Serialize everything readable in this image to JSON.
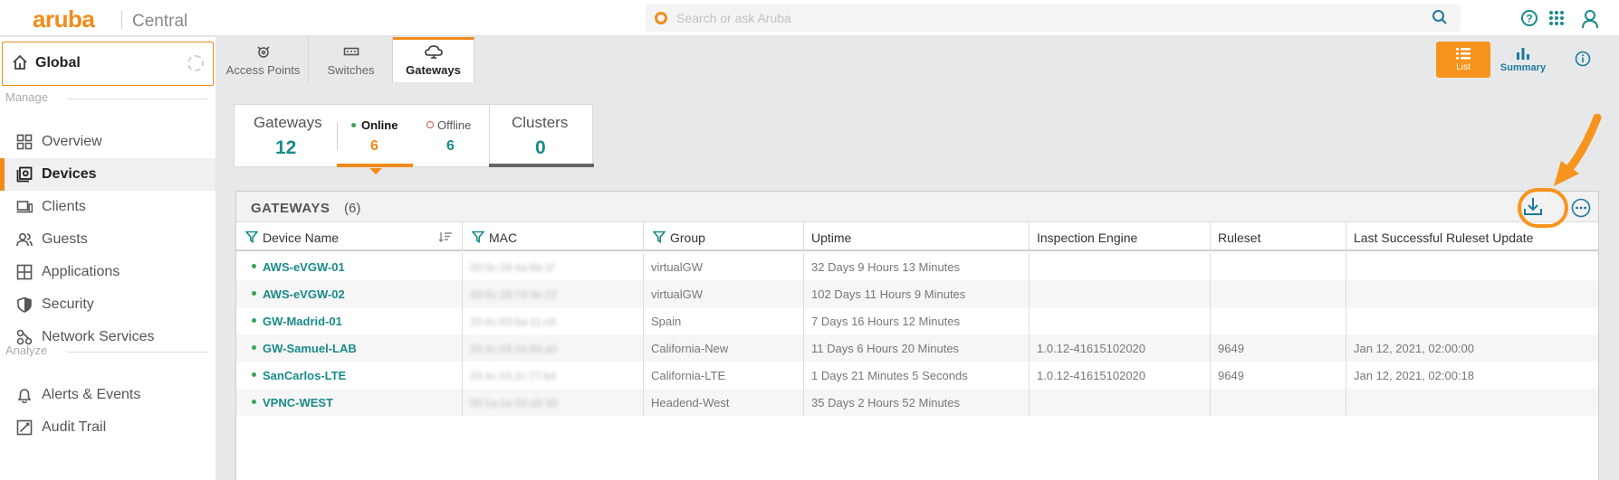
{
  "app": {
    "brand": "aruba",
    "product": "Central",
    "search_placeholder": "Search or ask Aruba"
  },
  "colors": {
    "accent": "#f28b1a",
    "teal": "#1a8a8a",
    "online": "#3aa35b",
    "offline": "#d9534f"
  },
  "sidebar": {
    "scope_label": "Global",
    "sections": [
      {
        "title": "Manage"
      },
      {
        "title": "Analyze"
      }
    ],
    "items": [
      {
        "label": "Overview",
        "icon": "grid-icon"
      },
      {
        "label": "Devices",
        "icon": "devices-icon",
        "active": true
      },
      {
        "label": "Clients",
        "icon": "clients-icon"
      },
      {
        "label": "Guests",
        "icon": "guests-icon"
      },
      {
        "label": "Applications",
        "icon": "apps-icon"
      },
      {
        "label": "Security",
        "icon": "shield-icon"
      },
      {
        "label": "Network Services",
        "icon": "network-services-icon"
      },
      {
        "label": "Alerts & Events",
        "icon": "bell-icon"
      },
      {
        "label": "Audit Trail",
        "icon": "audit-icon"
      }
    ]
  },
  "device_tabs": [
    {
      "label": "Access Points",
      "icon": "access-point-icon"
    },
    {
      "label": "Switches",
      "icon": "switch-icon"
    },
    {
      "label": "Gateways",
      "icon": "gateway-icon",
      "active": true
    }
  ],
  "views": {
    "list": "List",
    "summary": "Summary"
  },
  "summary": {
    "gateways_label": "Gateways",
    "gateways_count": "12",
    "online_label": "Online",
    "online_count": "6",
    "offline_label": "Offline",
    "offline_count": "6",
    "clusters_label": "Clusters",
    "clusters_count": "0"
  },
  "table": {
    "title": "GATEWAYS",
    "count": "(6)",
    "columns": [
      "Device Name",
      "MAC",
      "Group",
      "Uptime",
      "Inspection Engine",
      "Ruleset",
      "Last Successful Ruleset Update"
    ],
    "rows": [
      {
        "name": "AWS-eVGW-01",
        "mac": "00:0c:29:4a:8b:1f",
        "group": "virtualGW",
        "uptime": "32 Days 9 Hours 13 Minutes",
        "engine": "",
        "ruleset": "",
        "last_update": ""
      },
      {
        "name": "AWS-eVGW-02",
        "mac": "00:0c:29:7d:3e:22",
        "group": "virtualGW",
        "uptime": "102 Days 11 Hours 9 Minutes",
        "engine": "",
        "ruleset": "",
        "last_update": ""
      },
      {
        "name": "GW-Madrid-01",
        "mac": "20:4c:03:5a:11:c9",
        "group": "Spain",
        "uptime": "7 Days 16 Hours 12 Minutes",
        "engine": "",
        "ruleset": "",
        "last_update": ""
      },
      {
        "name": "GW-Samuel-LAB",
        "mac": "20:4c:03:1b:66:a0",
        "group": "California-New",
        "uptime": "11 Days 6 Hours 20 Minutes",
        "engine": "1.0.12-41615102020",
        "ruleset": "9649",
        "last_update": "Jan 12, 2021, 02:00:00"
      },
      {
        "name": "SanCarlos-LTE",
        "mac": "20:4c:03:2c:77:b4",
        "group": "California-LTE",
        "uptime": "1 Days 21 Minutes 5 Seconds",
        "engine": "1.0.12-41615102020",
        "ruleset": "9649",
        "last_update": "Jan 12, 2021, 02:00:18"
      },
      {
        "name": "VPNC-WEST",
        "mac": "00:1a:1e:02:d2:30",
        "group": "Headend-West",
        "uptime": "35 Days 2 Hours 52 Minutes",
        "engine": "",
        "ruleset": "",
        "last_update": ""
      }
    ]
  }
}
